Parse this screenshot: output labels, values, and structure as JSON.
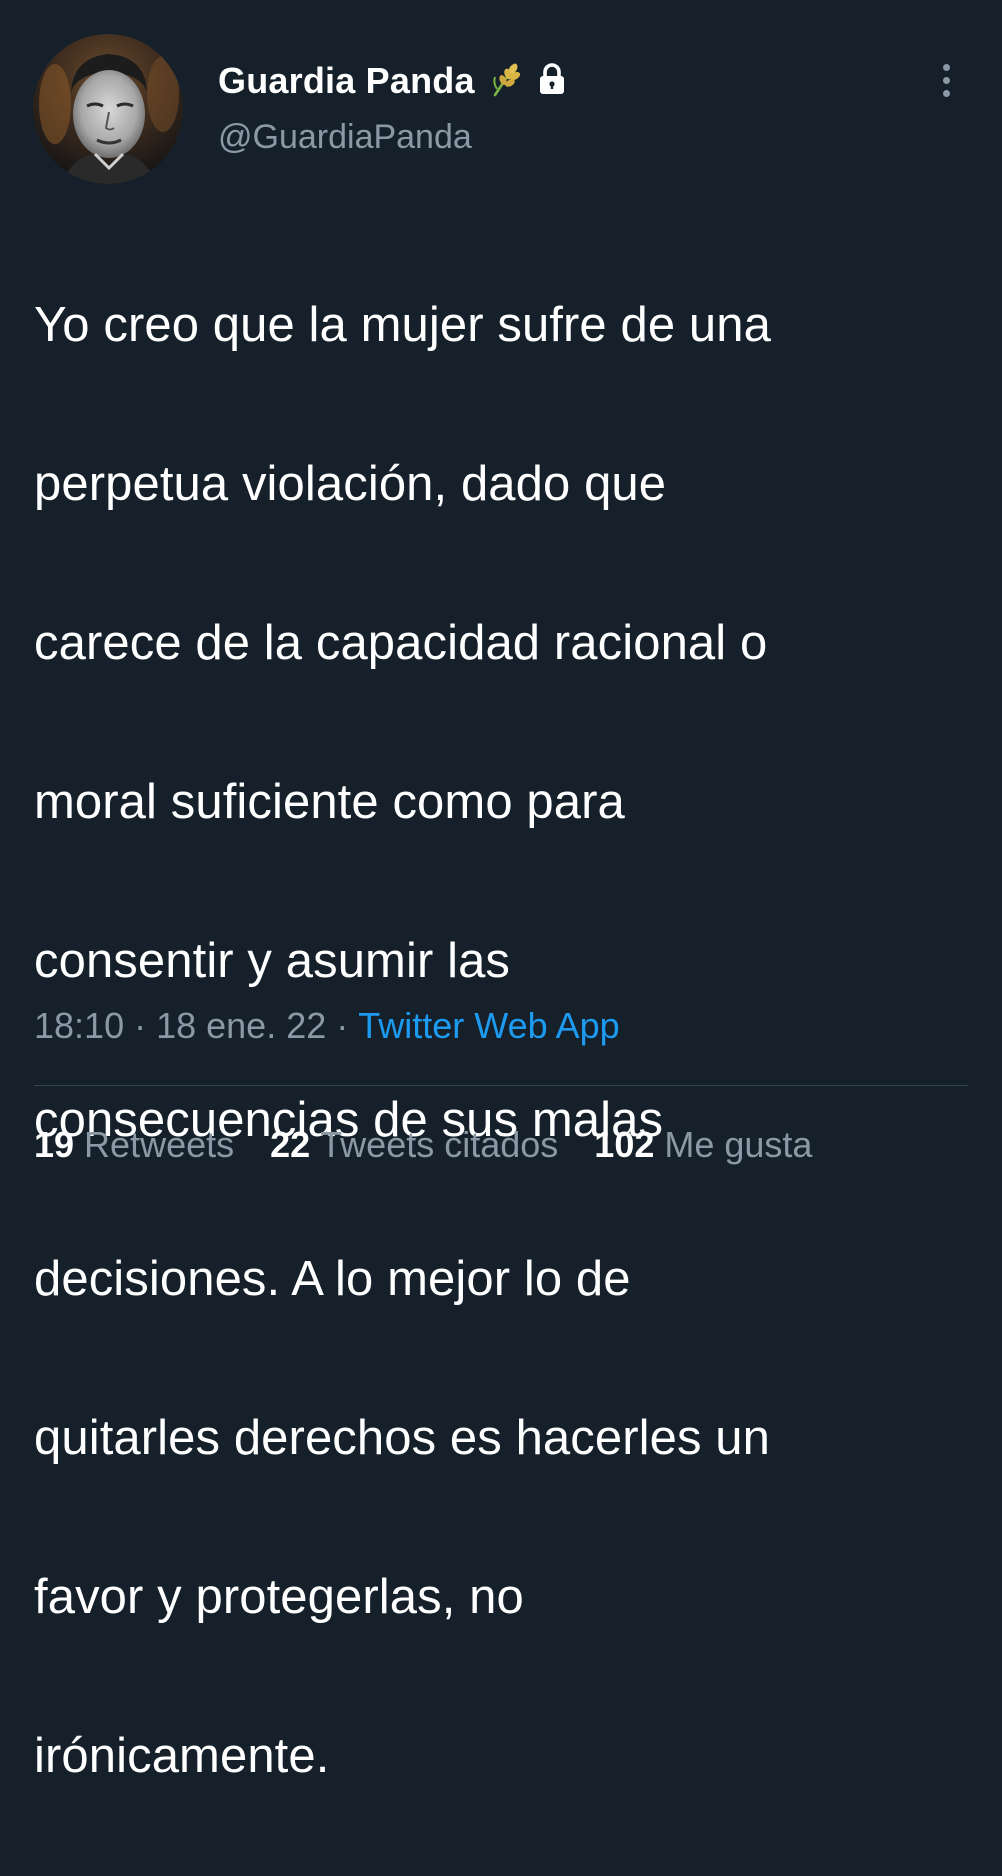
{
  "author": {
    "display_name": "Guardia Panda",
    "handle": "@GuardiaPanda",
    "badge_icon": "wheat-emoji-icon",
    "protected_icon": "lock-icon"
  },
  "tweet": {
    "text_lines": [
      "Yo creo que la mujer sufre de una",
      "perpetua violación, dado que",
      "carece de la capacidad racional o",
      "moral suficiente como para",
      "consentir y asumir las",
      "consecuencias de sus malas",
      "decisiones. A lo mejor lo de",
      "quitarles derechos es hacerles un",
      "favor y protegerlas, no",
      "irónicamente."
    ],
    "time": "18:10",
    "separator": "·",
    "date": "18 ene. 22",
    "source": "Twitter Web App"
  },
  "stats": {
    "retweets_count": "19",
    "retweets_label": "Retweets",
    "quotes_count": "22",
    "quotes_label": "Tweets citados",
    "likes_count": "102",
    "likes_label": "Me gusta"
  },
  "colors": {
    "background": "#15202b",
    "text_primary": "#ffffff",
    "text_secondary": "#8b98a5",
    "link": "#1d9bf0",
    "divider": "#38444d"
  }
}
